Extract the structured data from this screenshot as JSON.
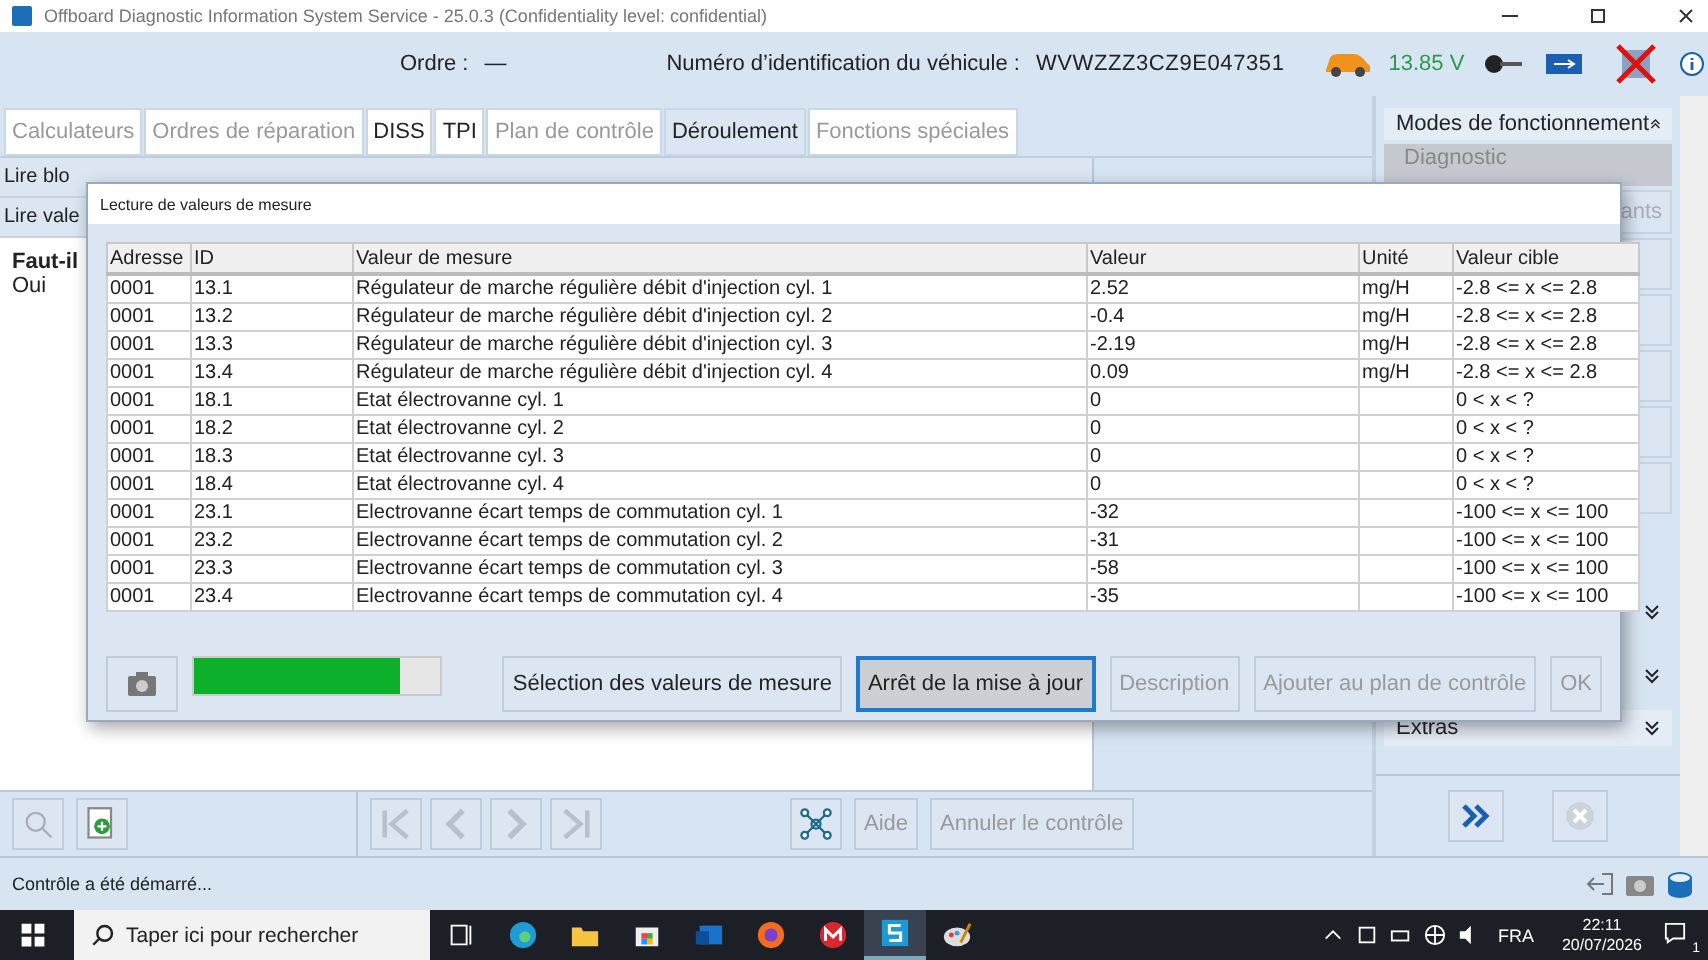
{
  "window": {
    "title": "Offboard Diagnostic Information System Service - 25.0.3 (Confidentiality level: confidential)"
  },
  "header": {
    "order_label": "Ordre :",
    "order_value": "—",
    "vin_label": "Numéro d’identification du véhicule :",
    "vin": "WVWZZZ3CZ9E047351",
    "voltage": "13.85 V"
  },
  "tabs": [
    {
      "label": "Calculateurs",
      "selected": false,
      "disabled": true
    },
    {
      "label": "Ordres de réparation",
      "selected": false,
      "disabled": true
    },
    {
      "label": "DISS",
      "selected": false,
      "disabled": false
    },
    {
      "label": "TPI",
      "selected": false,
      "disabled": false
    },
    {
      "label": "Plan de contrôle",
      "selected": false,
      "disabled": true
    },
    {
      "label": "Déroulement",
      "selected": true,
      "disabled": false
    },
    {
      "label": "Fonctions spéciales",
      "selected": false,
      "disabled": true
    }
  ],
  "procedure": {
    "steps": [
      "Lire blo",
      "Lire vale"
    ],
    "question": "Faut-il",
    "answer": "Oui"
  },
  "sidebar": {
    "title": "Modes de fonctionnement",
    "mode": "Diagnostic",
    "item_fragment": "ants",
    "extras": "Extras"
  },
  "toolbar": {
    "buttons": [
      {
        "label": "Aide",
        "disabled": true
      },
      {
        "label": "Annuler le contrôle",
        "disabled": true
      }
    ]
  },
  "dialog": {
    "title": "Lecture de valeurs de mesure",
    "columns": [
      "Adresse",
      "ID",
      "Valeur de mesure",
      "Valeur",
      "Unité",
      "Valeur cible"
    ],
    "rows": [
      [
        "0001",
        "13.1",
        "Régulateur de marche régulière débit d'injection cyl. 1",
        "2.52",
        "mg/H",
        "-2.8 <= x <= 2.8"
      ],
      [
        "0001",
        "13.2",
        "Régulateur de marche régulière débit d'injection cyl. 2",
        "-0.4",
        "mg/H",
        "-2.8 <= x <= 2.8"
      ],
      [
        "0001",
        "13.3",
        "Régulateur de marche régulière débit d'injection cyl. 3",
        "-2.19",
        "mg/H",
        "-2.8 <= x <= 2.8"
      ],
      [
        "0001",
        "13.4",
        "Régulateur de marche régulière débit d'injection cyl. 4",
        "0.09",
        "mg/H",
        "-2.8 <= x <= 2.8"
      ],
      [
        "0001",
        "18.1",
        "Etat électrovanne cyl. 1",
        "0",
        "",
        "0 < x < ?"
      ],
      [
        "0001",
        "18.2",
        "Etat électrovanne cyl. 2",
        "0",
        "",
        "0 < x < ?"
      ],
      [
        "0001",
        "18.3",
        "Etat électrovanne cyl. 3",
        "0",
        "",
        "0 < x < ?"
      ],
      [
        "0001",
        "18.4",
        "Etat électrovanne cyl. 4",
        "0",
        "",
        "0 < x < ?"
      ],
      [
        "0001",
        "23.1",
        "Electrovanne écart temps de commutation cyl. 1",
        "-32",
        "",
        "-100 <= x <= 100"
      ],
      [
        "0001",
        "23.2",
        "Electrovanne écart temps de commutation cyl. 2",
        "-31",
        "",
        "-100 <= x <= 100"
      ],
      [
        "0001",
        "23.3",
        "Electrovanne écart temps de commutation cyl. 3",
        "-58",
        "",
        "-100 <= x <= 100"
      ],
      [
        "0001",
        "23.4",
        "Electrovanne écart temps de commutation cyl. 4",
        "-35",
        "",
        "-100 <= x <= 100"
      ]
    ],
    "progress": {
      "level": 0.84
    },
    "buttons": [
      {
        "label": "Sélection des valeurs de mesure",
        "disabled": false,
        "focused": false
      },
      {
        "label": "Arrêt de la mise à jour",
        "disabled": false,
        "focused": true
      },
      {
        "label": "Description",
        "disabled": true,
        "focused": false
      },
      {
        "label": "Ajouter au plan de contrôle",
        "disabled": true,
        "focused": false
      },
      {
        "label": "OK",
        "disabled": true,
        "focused": false
      }
    ]
  },
  "status_bar": {
    "text": "Contrôle a été démarré..."
  },
  "taskbar": {
    "search_placeholder": "Taper ici pour rechercher",
    "language": "FRA",
    "time": "22:11",
    "date": "20/07/2026",
    "notifications": "1"
  }
}
